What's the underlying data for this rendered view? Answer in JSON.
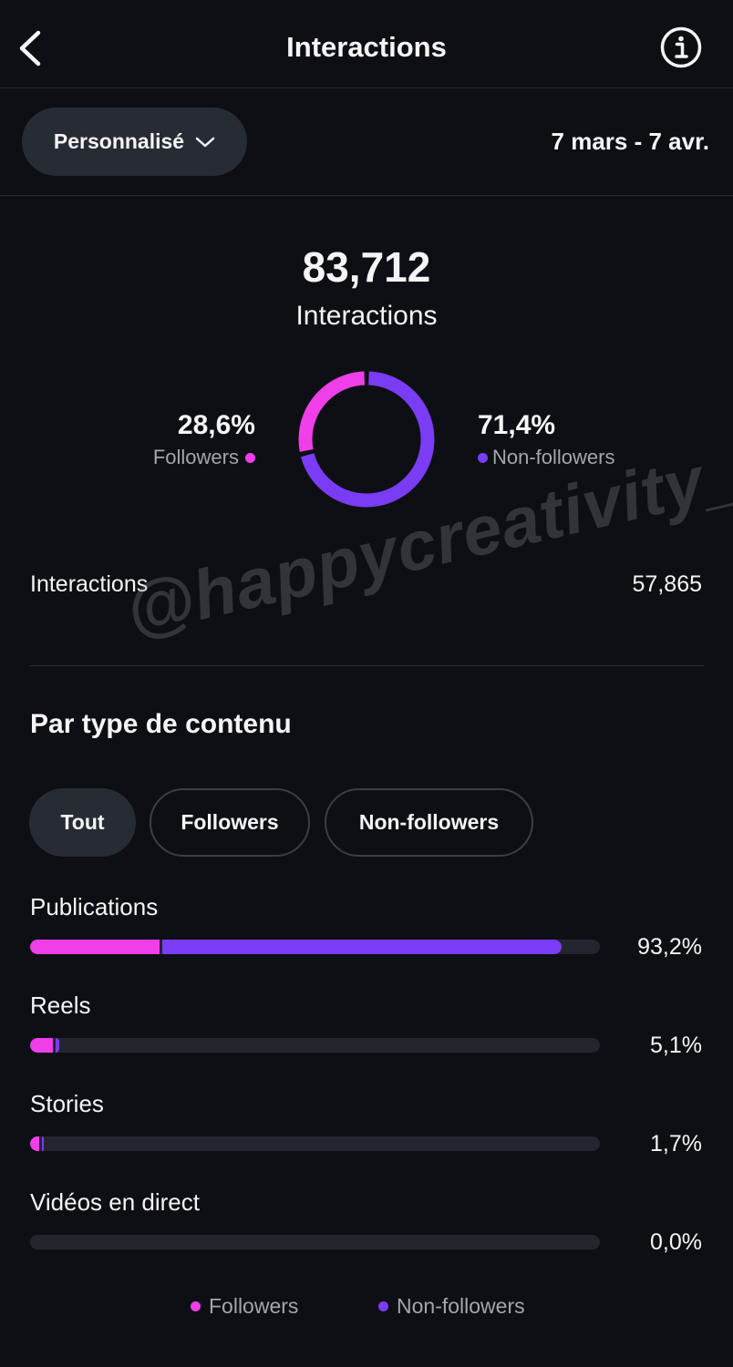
{
  "header": {
    "title": "Interactions"
  },
  "filter": {
    "period_label": "Personnalisé",
    "date_range": "7 mars - 7 avr."
  },
  "summary": {
    "total": "83,712",
    "label": "Interactions"
  },
  "split": {
    "followers_pct": "28,6%",
    "followers_label": "Followers",
    "followers_fraction": 0.286,
    "non_followers_pct": "71,4%",
    "non_followers_label": "Non-followers",
    "non_followers_fraction": 0.714
  },
  "interactions_row": {
    "label": "Interactions",
    "value": "57,865"
  },
  "content_section": {
    "title": "Par type de contenu",
    "chips": [
      "Tout",
      "Followers",
      "Non-followers"
    ],
    "rows": [
      {
        "label": "Publications",
        "pct": "93,2%",
        "followers_share": 0.227,
        "non_followers_share": 0.705
      },
      {
        "label": "Reels",
        "pct": "5,1%",
        "followers_share": 0.04,
        "non_followers_share": 0.011
      },
      {
        "label": "Stories",
        "pct": "1,7%",
        "followers_share": 0.016,
        "non_followers_share": 0.001
      },
      {
        "label": "Vidéos en direct",
        "pct": "0,0%",
        "followers_share": 0,
        "non_followers_share": 0
      }
    ]
  },
  "legend": {
    "followers": "Followers",
    "non_followers": "Non-followers"
  },
  "colors": {
    "followers": "#f03ee8",
    "non_followers": "#7b3cf5",
    "background": "#0d0f14"
  },
  "icons": {
    "back": "chevron-left-icon",
    "info": "info-circle-icon",
    "dropdown": "chevron-down-icon"
  },
  "watermark": "@happycreativity_"
}
